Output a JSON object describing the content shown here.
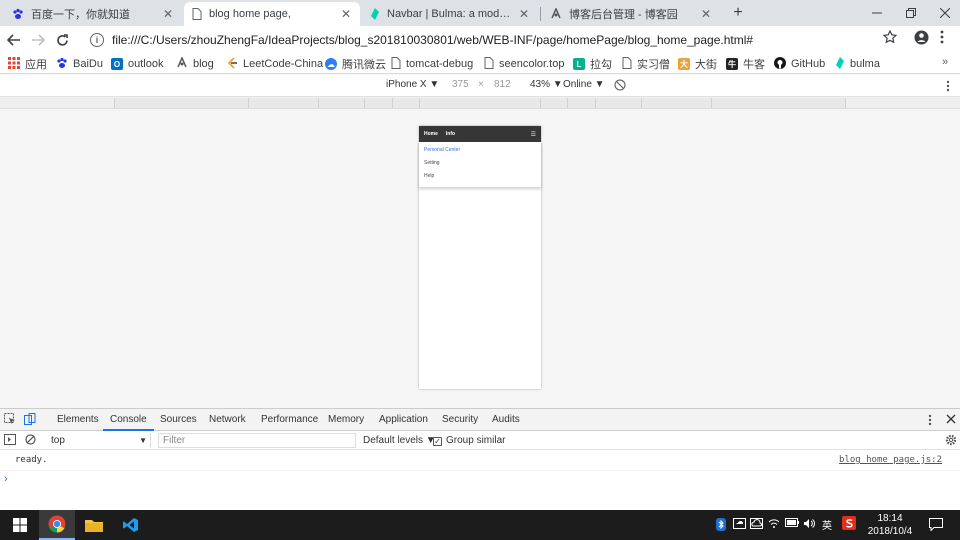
{
  "browser": {
    "tabs": [
      {
        "title": "百度一下，你就知道",
        "icon": "baidu-paw-icon",
        "active": false
      },
      {
        "title": "blog home page,",
        "icon": "file-page-icon",
        "active": true
      },
      {
        "title": "Navbar | Bulma: a modern CSS",
        "icon": "bulma-icon",
        "active": false
      },
      {
        "title": "博客后台管理 - 博客园",
        "icon": "cnblogs-icon",
        "active": false
      }
    ],
    "new_tab_label": "+",
    "url": "file:///C:/Users/zhouZhengFa/IdeaProjects/blog_s201810030801/web/WEB-INF/page/homePage/blog_home_page.html#"
  },
  "bookmarks": [
    {
      "label": "应用",
      "icon": "apps-grid-icon",
      "color": "#e94235"
    },
    {
      "label": "BaiDu",
      "icon": "baidu-paw-icon",
      "color": "#2932e1"
    },
    {
      "label": "outlook",
      "icon": "outlook-icon",
      "color": "#0072c6"
    },
    {
      "label": "blog",
      "icon": "cnblogs-icon",
      "color": "#555555"
    },
    {
      "label": "LeetCode-China",
      "icon": "leetcode-icon",
      "color": "#f89f1b"
    },
    {
      "label": "腾讯微云",
      "icon": "weiyun-icon",
      "color": "#2f7cf6"
    },
    {
      "label": "tomcat-debug",
      "icon": "page-icon",
      "color": "#ffffff"
    },
    {
      "label": "seencolor.top",
      "icon": "page-icon",
      "color": "#ffffff"
    },
    {
      "label": "拉勾",
      "icon": "lagou-icon",
      "color": "#00b38a"
    },
    {
      "label": "实习僧",
      "icon": "page-icon",
      "color": "#ffffff"
    },
    {
      "label": "大街",
      "icon": "dajie-icon",
      "color": "#e8a33d"
    },
    {
      "label": "牛客",
      "icon": "nowcoder-icon",
      "color": "#222222"
    },
    {
      "label": "GitHub",
      "icon": "github-icon",
      "color": "#181717"
    },
    {
      "label": "bulma",
      "icon": "bulma-icon",
      "color": "#00d1b2"
    }
  ],
  "bookmarks_more": "»",
  "device_toolbar": {
    "device": "iPhone X ▼",
    "width": "375",
    "times": "×",
    "height": "812",
    "zoom": "43% ▼",
    "throttle": "Online ▼"
  },
  "page": {
    "navbar_items": [
      "Home",
      "Info"
    ],
    "burger": "☰",
    "dropdown_items": [
      "Personal Center",
      "Setting",
      "Help"
    ]
  },
  "devtools": {
    "tabs": [
      "Elements",
      "Console",
      "Sources",
      "Network",
      "Performance",
      "Memory",
      "Application",
      "Security",
      "Audits"
    ],
    "active_tab": "Console",
    "context": "top",
    "filter_placeholder": "Filter",
    "levels": "Default levels ▼",
    "group_similar": "Group similar",
    "group_similar_checked": true,
    "log_message": "ready.",
    "log_source": "blog_home_page.js:2",
    "prompt": "›"
  },
  "taskbar": {
    "time": "18:14",
    "date": "2018/10/4",
    "ime": "英"
  }
}
